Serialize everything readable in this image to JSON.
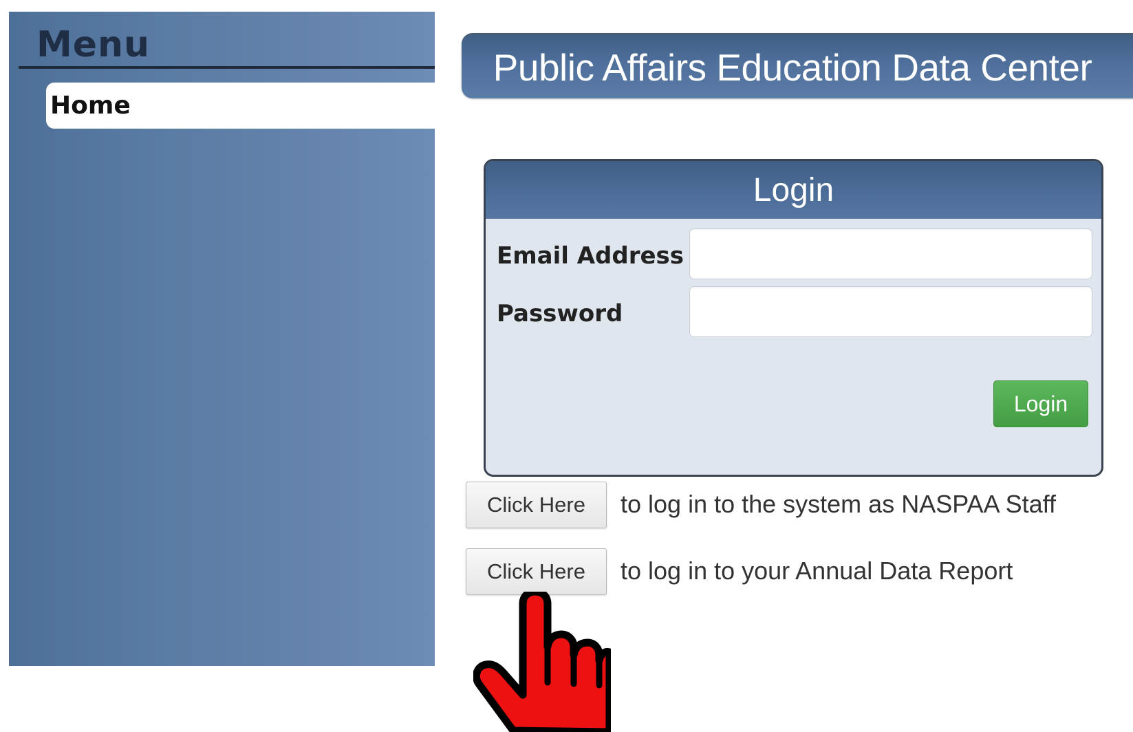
{
  "sidebar": {
    "title": "Menu",
    "items": [
      {
        "label": "Home",
        "selected": true
      }
    ]
  },
  "header": {
    "title": "Public Affairs Education Data Center"
  },
  "login": {
    "title": "Login",
    "email_label": "Email Address",
    "email_value": "",
    "password_label": "Password",
    "password_value": "",
    "button_label": "Login"
  },
  "links": [
    {
      "button_label": "Click Here",
      "description": "to log in to the system as NASPAA Staff"
    },
    {
      "button_label": "Click Here",
      "description": "to log in to your Annual Data Report"
    }
  ],
  "colors": {
    "sidebar_blue": "#5a7ba3",
    "header_blue": "#4f709b",
    "login_green": "#4cae4c",
    "panel_bg": "#e0e6ee",
    "cursor_red": "#ee1111"
  },
  "icons": {
    "cursor": "hand-pointer-icon"
  }
}
